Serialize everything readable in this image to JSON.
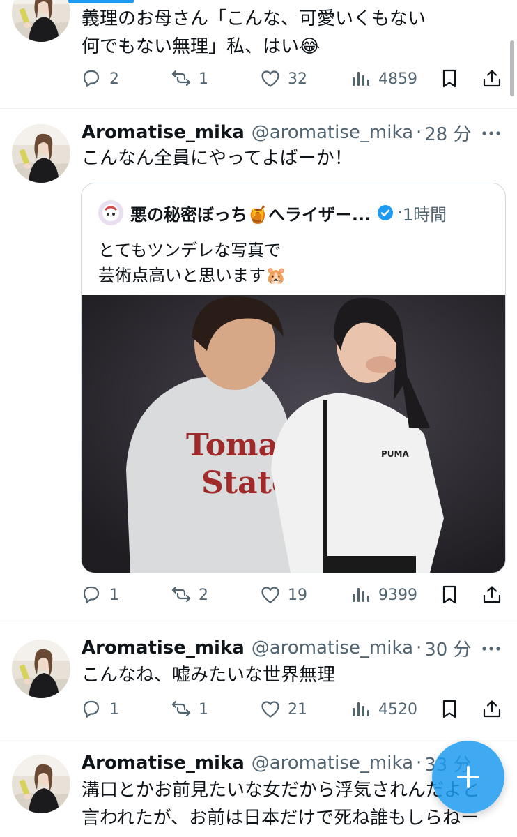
{
  "tweets": [
    {
      "text_lines": [
        "義理のお母さん「こんな、可愛いくもない",
        "何でもない無理」私、はい😂"
      ],
      "stats": {
        "replies": "2",
        "reposts": "1",
        "likes": "32",
        "views": "4859"
      }
    },
    {
      "name": "Aromatise_mika",
      "handle": "@aromatise_mika",
      "time": "28 分",
      "text_lines": [
        "こんなん全員にやってよばーか！"
      ],
      "quote": {
        "name": "悪の秘密ぼっち🍯へライザー...",
        "time": "1時間",
        "text_lines": [
          "とてもツンデレな写真で",
          "芸術点高いと思います🐹"
        ],
        "photo_shirt_text_1": "Tomat",
        "photo_shirt_text_2": "State",
        "photo_shirt_text_3": "PUMA"
      },
      "stats": {
        "replies": "1",
        "reposts": "2",
        "likes": "19",
        "views": "9399"
      }
    },
    {
      "name": "Aromatise_mika",
      "handle": "@aromatise_mika",
      "time": "30 分",
      "text_lines": [
        "こんなね、嘘みたいな世界無理"
      ],
      "stats": {
        "replies": "1",
        "reposts": "1",
        "likes": "21",
        "views": "4520"
      }
    },
    {
      "name": "Aromatise_mika",
      "handle": "@aromatise_mika",
      "time": "33 分",
      "text_lines": [
        "溝口とかお前見たいな女だから浮気されんだよと",
        "言われたが、お前は日本だけで死ね誰もしらねー"
      ]
    }
  ],
  "icons": {
    "reply": "reply-icon",
    "repost": "repost-icon",
    "like": "heart-icon",
    "views": "views-icon",
    "bookmark": "bookmark-icon",
    "share": "share-icon",
    "more": "more-icon",
    "compose": "plus-icon",
    "verified": "verified-badge-icon"
  },
  "colors": {
    "accent": "#1d9bf0",
    "secondary_text": "#536471",
    "primary_text": "#0f1419"
  }
}
